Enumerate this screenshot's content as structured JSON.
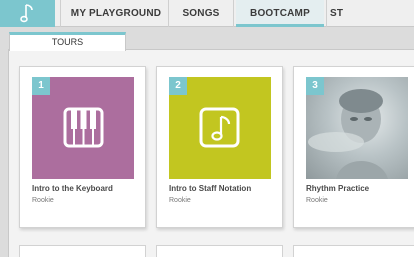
{
  "nav": {
    "items": [
      {
        "label": "MY PLAYGROUND"
      },
      {
        "label": "SONGS"
      },
      {
        "label": "BOOTCAMP"
      },
      {
        "label": "ST"
      }
    ],
    "active": "BOOTCAMP",
    "accent_color": "#7cc6ce"
  },
  "subtab": {
    "label": "TOURS"
  },
  "cards": [
    {
      "number": "1",
      "title": "Intro to the Keyboard",
      "level": "Rookie",
      "color": "#ac6e9e",
      "icon": "piano-keys-icon"
    },
    {
      "number": "2",
      "title": "Intro to Staff Notation",
      "level": "Rookie",
      "color": "#c2c620",
      "icon": "music-note-icon"
    },
    {
      "number": "3",
      "title": "Rhythm Practice",
      "level": "Rookie",
      "color": "#b8c2c4",
      "icon": "photo-thumbnail"
    }
  ]
}
